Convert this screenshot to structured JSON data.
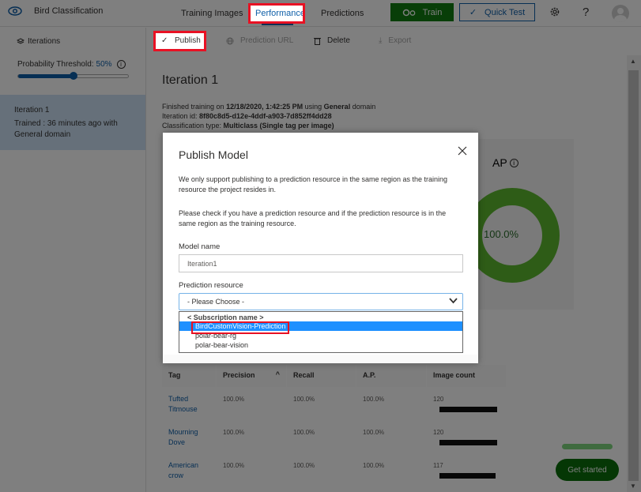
{
  "app": {
    "title": "Bird Classification",
    "nav_tabs": [
      {
        "label": "Training Images",
        "active": false
      },
      {
        "label": "Performance",
        "active": true
      },
      {
        "label": "Predictions",
        "active": false
      }
    ],
    "train_label": "Train",
    "quick_test_label": "Quick Test",
    "help_label": "?"
  },
  "sidebar": {
    "header": "Iterations",
    "threshold_label": "Probability Threshold:",
    "threshold_value": "50%",
    "threshold_fraction": 0.5,
    "info_label": "i",
    "iteration": {
      "title": "Iteration 1",
      "subtitle": "Trained : 36 minutes ago with General domain"
    }
  },
  "commands": {
    "publish": "Publish",
    "prediction_url": "Prediction URL",
    "delete": "Delete",
    "export": "Export"
  },
  "iteration_detail": {
    "title": "Iteration 1",
    "finished_prefix": "Finished training on ",
    "finished_date": "12/18/2020, 1:42:25 PM",
    "finished_mid": " using ",
    "finished_domain": "General",
    "finished_suffix": " domain",
    "id_prefix": "Iteration id: ",
    "id_value": "8f80c8d5-d12e-4ddf-a903-7d852ff4dd28",
    "type_prefix": "Classification type: ",
    "type_value": "Multiclass (Single tag per image)"
  },
  "ap_card": {
    "title": "AP",
    "info": "i",
    "value": "100.0%",
    "color": "#5cb82e"
  },
  "table": {
    "headers": [
      "Tag",
      "Precision",
      "Recall",
      "A.P.",
      "Image count"
    ],
    "sort_indicator": "^",
    "max_count": 120,
    "rows": [
      {
        "tag": "Tufted Titmouse",
        "precision": "100.0%",
        "recall": "100.0%",
        "ap": "100.0%",
        "count": 120
      },
      {
        "tag": "Mourning Dove",
        "precision": "100.0%",
        "recall": "100.0%",
        "ap": "100.0%",
        "count": 120
      },
      {
        "tag": "American crow",
        "precision": "100.0%",
        "recall": "100.0%",
        "ap": "100.0%",
        "count": 117
      }
    ]
  },
  "get_started_label": "Get started",
  "modal": {
    "title": "Publish Model",
    "paragraph1": "We only support publishing to a prediction resource in the same region as the training resource the project resides in.",
    "paragraph2": "Please check if you have a prediction resource and if the prediction resource is in the same region as the training resource.",
    "model_name_label": "Model name",
    "model_name_value": "Iteration1",
    "prediction_resource_label": "Prediction resource",
    "select_placeholder": "- Please Choose -",
    "option_group": "< Subscription name >",
    "options": [
      {
        "label": "BirdCustomVision-Prediction",
        "selected": true
      },
      {
        "label": "polar-bear-rg",
        "selected": false
      },
      {
        "label": "polar-bear-vision",
        "selected": false
      }
    ]
  },
  "colors": {
    "accent": "#0f5fa8",
    "train_green": "#107c10",
    "highlight_red": "#e81123",
    "selected_option": "#1e90ff"
  }
}
